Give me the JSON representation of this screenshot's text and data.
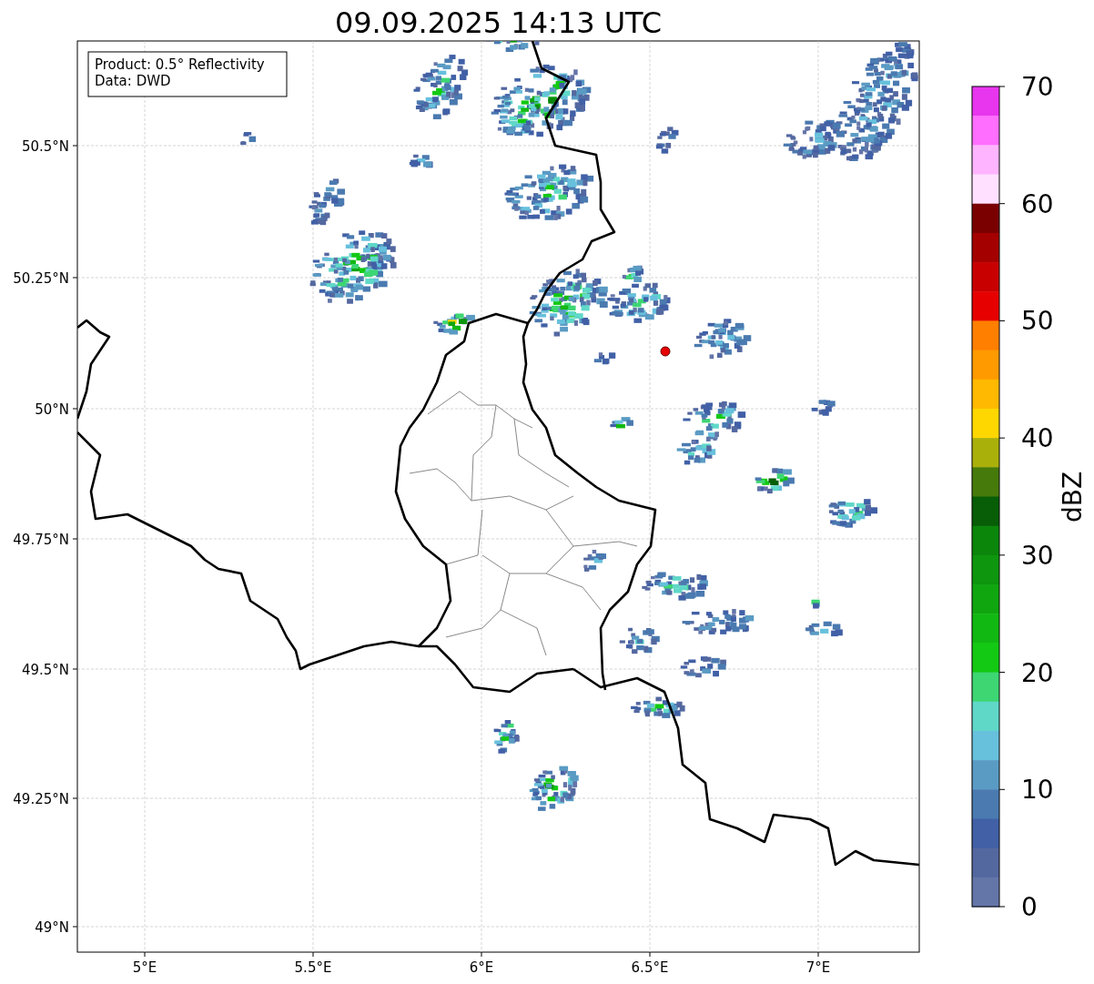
{
  "title": "09.09.2025 14:13 UTC",
  "info_box": [
    "Product: 0.5° Reflectivity",
    "Data: DWD"
  ],
  "x_ticks": [
    "5°E",
    "5.5°E",
    "6°E",
    "6.5°E",
    "7°E"
  ],
  "y_ticks": [
    "50.5°N",
    "50.25°N",
    "50°N",
    "49.75°N",
    "49.5°N",
    "49.25°N",
    "49°N"
  ],
  "colorbar": {
    "label": "dBZ",
    "ticks": [
      "70",
      "60",
      "50",
      "40",
      "30",
      "20",
      "10",
      "0"
    ],
    "segments": [
      {
        "color": "#e835ee"
      },
      {
        "color": "#ff6eff"
      },
      {
        "color": "#ffb4ff"
      },
      {
        "color": "#ffe0ff"
      },
      {
        "color": "#7a0000"
      },
      {
        "color": "#a50000"
      },
      {
        "color": "#c80000"
      },
      {
        "color": "#e60000"
      },
      {
        "color": "#ff7f00"
      },
      {
        "color": "#ff9a00"
      },
      {
        "color": "#ffb900"
      },
      {
        "color": "#ffd700"
      },
      {
        "color": "#aab00a"
      },
      {
        "color": "#467a0a"
      },
      {
        "color": "#075e07"
      },
      {
        "color": "#0b860b"
      },
      {
        "color": "#0e960e"
      },
      {
        "color": "#10a610"
      },
      {
        "color": "#12b812"
      },
      {
        "color": "#13c913"
      },
      {
        "color": "#3dd673"
      },
      {
        "color": "#60d8c8"
      },
      {
        "color": "#67c0dc"
      },
      {
        "color": "#5a9bc4"
      },
      {
        "color": "#4a7ab0"
      },
      {
        "color": "#4160a6"
      },
      {
        "color": "#5468a0"
      },
      {
        "color": "#6475a8"
      }
    ]
  }
}
